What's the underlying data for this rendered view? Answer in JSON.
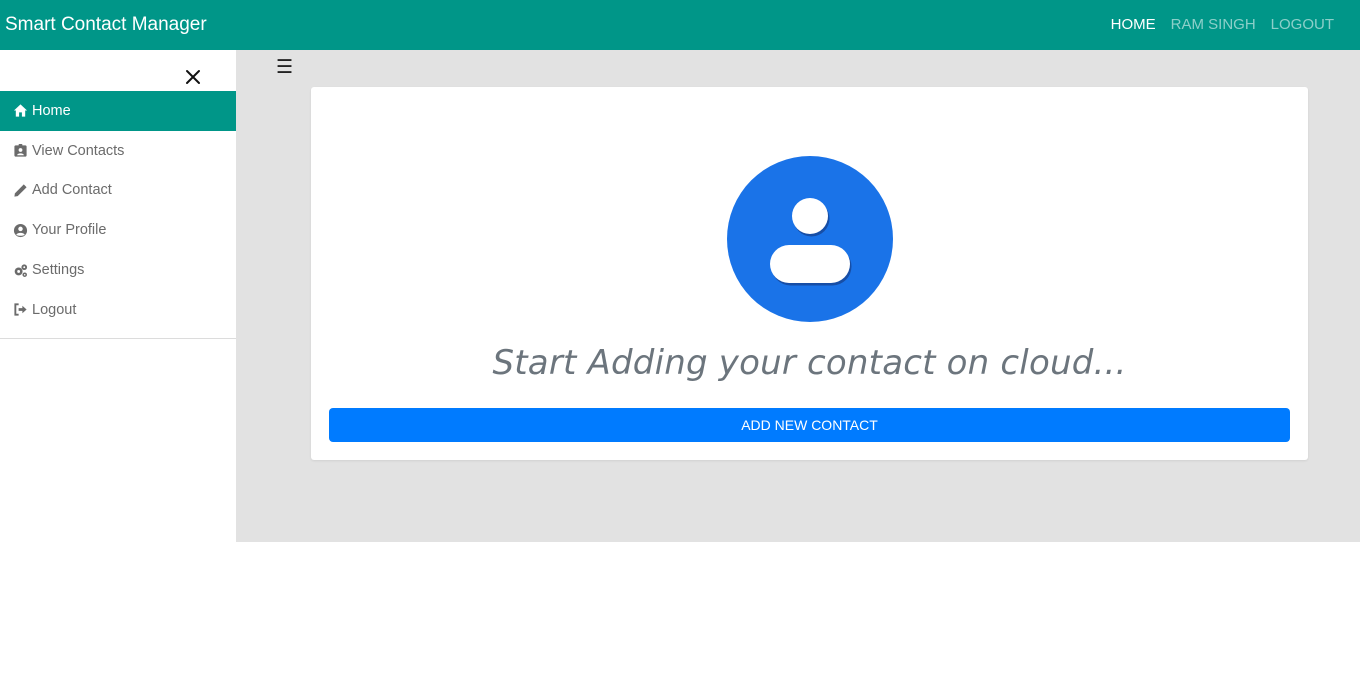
{
  "app": {
    "title": "Smart Contact Manager"
  },
  "topnav": {
    "items": [
      {
        "label": "HOME",
        "active": true
      },
      {
        "label": "RAM SINGH",
        "active": false
      },
      {
        "label": "LOGOUT",
        "active": false
      }
    ]
  },
  "sidebar": {
    "close_icon": "close-icon",
    "items": [
      {
        "label": "Home",
        "icon": "home-icon",
        "active": true
      },
      {
        "label": "View Contacts",
        "icon": "contacts-card-icon",
        "active": false
      },
      {
        "label": "Add Contact",
        "icon": "pencil-icon",
        "active": false
      },
      {
        "label": "Your Profile",
        "icon": "user-circle-icon",
        "active": false
      },
      {
        "label": "Settings",
        "icon": "gears-icon",
        "active": false
      },
      {
        "label": "Logout",
        "icon": "sign-out-icon",
        "active": false
      }
    ]
  },
  "main": {
    "hamburger_icon": "hamburger-icon",
    "headline": "Start Adding your contact on cloud...",
    "add_button_label": "ADD NEW CONTACT",
    "avatar_icon": "contact-avatar-icon"
  },
  "colors": {
    "primary": "#009688",
    "button": "#007bff",
    "avatar": "#1a73e8",
    "background": "#e2e2e2"
  }
}
